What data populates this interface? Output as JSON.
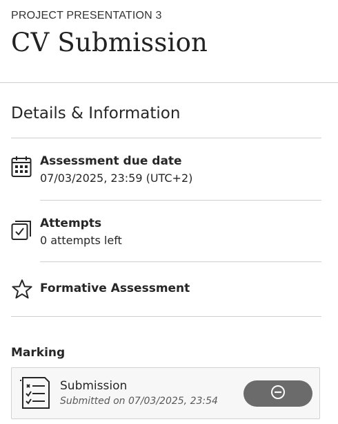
{
  "header": {
    "eyebrow": "PROJECT PRESENTATION 3",
    "title": "CV Submission"
  },
  "details": {
    "heading": "Details & Information",
    "due_date": {
      "label": "Assessment due date",
      "value": "07/03/2025, 23:59 (UTC+2)",
      "icon": "calendar-icon"
    },
    "attempts": {
      "label": "Attempts",
      "value": "0 attempts left",
      "icon": "attempts-icon"
    },
    "formative": {
      "label": "Formative Assessment",
      "icon": "star-icon"
    }
  },
  "marking": {
    "heading": "Marking",
    "submission": {
      "title": "Submission",
      "meta": "Submitted on 07/03/2025, 23:54",
      "icon": "checklist-icon",
      "status_icon": "minus-circle-icon"
    }
  }
}
